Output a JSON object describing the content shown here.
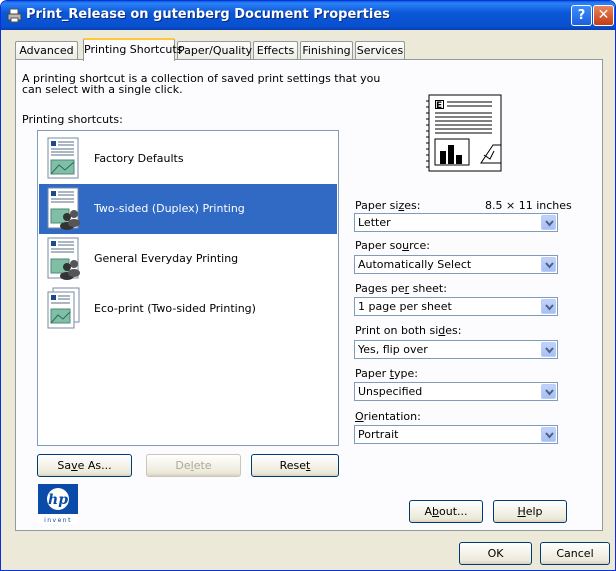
{
  "window": {
    "title": "Print_Release on gutenberg Document Properties"
  },
  "tabs": [
    {
      "label": "Advanced"
    },
    {
      "label": "Printing Shortcuts"
    },
    {
      "label": "Paper/Quality"
    },
    {
      "label": "Effects"
    },
    {
      "label": "Finishing"
    },
    {
      "label": "Services"
    }
  ],
  "description": "A printing shortcut is a collection of saved print settings that you can select with a single click.",
  "shortcuts_label": "Printing shortcuts:",
  "shortcuts": [
    {
      "label": "Factory Defaults",
      "icon": "document-icon"
    },
    {
      "label": "Two-sided (Duplex) Printing",
      "icon": "document-users-icon",
      "selected": true
    },
    {
      "label": "General Everyday Printing",
      "icon": "document-users-icon"
    },
    {
      "label": "Eco-print (Two-sided Printing)",
      "icon": "duplex-document-icon"
    }
  ],
  "buttons": {
    "save_as": {
      "pre": "Sa",
      "u": "v",
      "post": "e As..."
    },
    "delete": {
      "pre": "De",
      "u": "l",
      "post": "ete"
    },
    "reset": {
      "pre": "Rese",
      "u": "t",
      "post": ""
    },
    "about": {
      "pre": "A",
      "u": "b",
      "post": "out..."
    },
    "help": {
      "pre": "",
      "u": "H",
      "post": "elp"
    },
    "ok": "OK",
    "cancel": "Cancel"
  },
  "fields": {
    "paper_sizes": {
      "pre": "Paper si",
      "u": "z",
      "post": "es:",
      "dimension": "8.5 × 11 inches",
      "value": "Letter"
    },
    "paper_source": {
      "pre": "Paper so",
      "u": "u",
      "post": "rce:",
      "value": "Automatically Select"
    },
    "pages_per_sheet": {
      "pre": "Pages pe",
      "u": "r",
      "post": " sheet:",
      "value": "1 page per sheet"
    },
    "both_sides": {
      "pre": "Print on both si",
      "u": "d",
      "post": "es:",
      "value": "Yes, flip over"
    },
    "paper_type": {
      "pre": "Paper ",
      "u": "t",
      "post": "ype:",
      "value": "Unspecified"
    },
    "orientation": {
      "pre": "",
      "u": "O",
      "post": "rientation:",
      "value": "Portrait"
    }
  },
  "logo": {
    "text": "invent",
    "brand": "hp"
  },
  "colors": {
    "selection": "#316ac5",
    "titlebar": "#0a5fde",
    "tab_highlight": "#ffc83c"
  }
}
